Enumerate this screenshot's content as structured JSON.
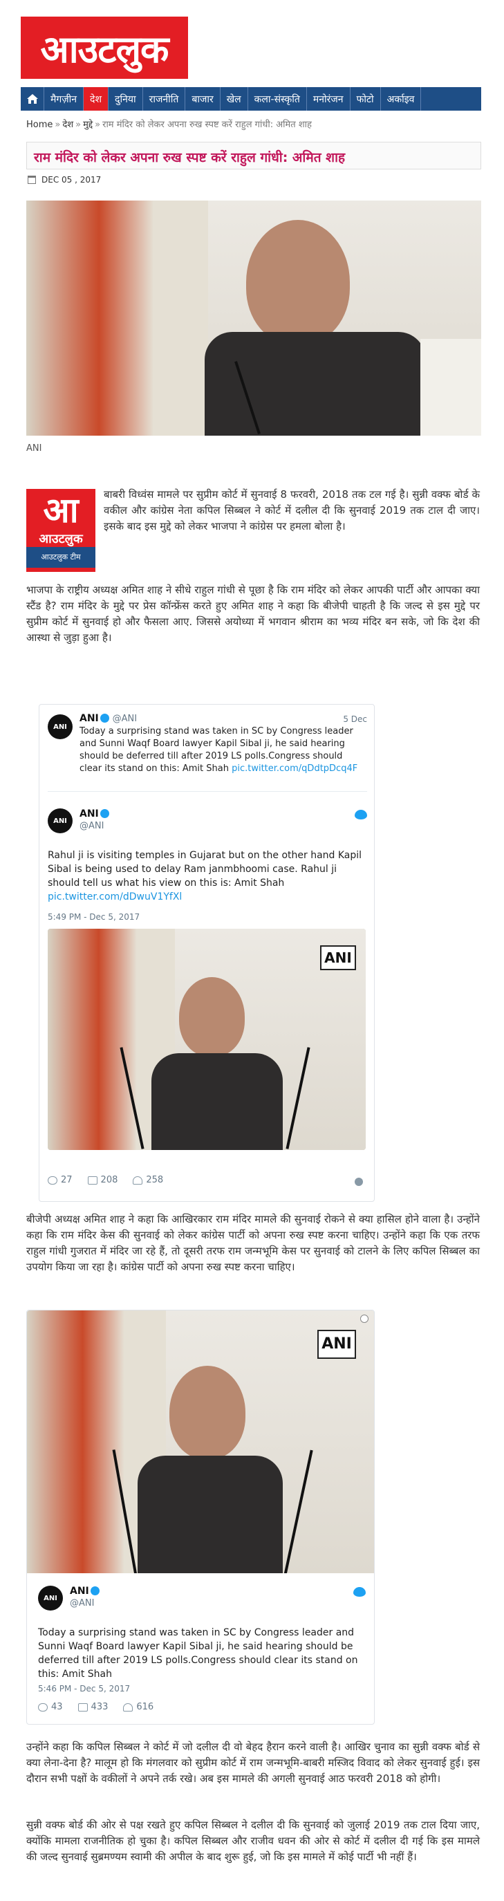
{
  "site": {
    "logo": "आउटलुक"
  },
  "nav": {
    "items": [
      "मैगज़ीन",
      "देश",
      "दुनिया",
      "राजनीति",
      "बाजार",
      "खेल",
      "कला-संस्कृति",
      "मनोरंजन",
      "फोटो",
      "अर्काइव"
    ],
    "active_index": 1,
    "colors": {
      "bar": "#1e4e86",
      "active": "#e31e24"
    }
  },
  "breadcrumb": {
    "home": "Home",
    "section": "देश",
    "sub": "मुद्दे",
    "current": "राम मंदिर को लेकर अपना रुख स्पष्ट करें राहुल गांधी: अमित शाह",
    "separator": "»"
  },
  "article": {
    "title": "राम मंदिर को लेकर अपना रुख स्पष्ट करें राहुल गांधी: अमित शाह",
    "date": "DEC 05 , 2017",
    "image_caption": "ANI",
    "author_badge": {
      "big": "आ",
      "mid": "आउटलुक",
      "small": "आउटलुक टीम"
    },
    "paragraphs": [
      "बाबरी विध्वंस मामले पर सुप्रीम कोर्ट में सुनवाई 8 फरवरी, 2018 तक टल गई है। सुन्नी वक्फ बोर्ड के वकील और कांग्रेस नेता कपिल सिब्बल ने कोर्ट में दलील दी कि सुनवाई 2019 तक टाल दी जाए। इसके बाद इस मुद्दे को लेकर भाजपा ने कांग्रेस पर हमला बोला है।",
      "भाजपा के राष्ट्रीय अध्यक्ष अमित शाह ने सीधे राहुल गांधी से पूछा है कि राम मंदिर को लेकर आपकी पार्टी और आपका क्या स्टैंड है? राम मंदिर के मुद्दे पर प्रेस कॉन्फ्रेंस करते हुए अमित शाह ने कहा कि बीजेपी चाहती है कि जल्द से इस मुद्दे पर सुप्रीम कोर्ट में सुनवाई हो और फैसला आए. जिससे अयोध्या में भगवान श्रीराम का भव्य मंदिर बन सके, जो कि देश की आस्था से जुड़ा हुआ है।",
      "बीजेपी अध्यक्ष अमित शाह ने कहा कि आखिरकार राम मंदिर मामले की सुनवाई रोकने से क्या हासिल होने वाला है। उन्होंने कहा कि राम मंदिर केस की सुनवाई को लेकर कांग्रेस पार्टी को अपना रुख स्पष्ट करना चाहिए। उन्होंने कहा कि एक तरफ राहुल गांधी गुजरात में मंदिर जा रहे हैं, तो दूसरी तरफ राम जन्मभूमि केस पर सुनवाई को टालने के लिए कपिल सिब्बल का उपयोग किया जा रहा है। कांग्रेस पार्टी को अपना रुख स्पष्ट करना चाहिए।",
      "उन्होंने कहा कि कपिल सिब्बल ने कोर्ट में जो दलील दी वो बेहद हैरान करने वाली है। आखिर चुनाव का सुन्नी वक्फ बोर्ड से क्या लेना-देना है? मालूम हो कि मंगलवार को सुप्रीम कोर्ट में राम जन्मभूमि-बाबरी मस्जिद विवाद को लेकर सुनवाई हुई। इस दौरान सभी पक्षों के वकीलों ने अपने तर्क रखे। अब इस मामले की अगली सुनवाई आठ फरवरी 2018 को होगी।",
      "सुन्नी वक्फ बोर्ड की ओर से पक्ष रखते हुए कपिल सिब्बल ने दलील दी कि सुनवाई को जुलाई 2019 तक टाल दिया जाए, क्योंकि मामला राजनीतिक हो चुका है। कपिल सिब्बल और राजीव धवन की ओर से कोर्ट में दलील दी गई कि इस मामले की जल्द सुनवाई सुब्रमण्यम स्वामी की अपील के बाद शुरू हुई, जो कि इस मामले में कोई पार्टी भी नहीं हैं।"
    ]
  },
  "tweet1": {
    "quoted": {
      "name": "ANI",
      "handle": "@ANI",
      "date": "5 Dec",
      "text": "Today a surprising stand was taken in SC by Congress leader and Sunni Waqf Board lawyer Kapil Sibal ji, he said hearing should be deferred till after 2019 LS polls.Congress should clear its stand on this: Amit Shah",
      "link": "pic.twitter.com/qDdtpDcq4F"
    },
    "name": "ANI",
    "handle": "@ANI",
    "text": "Rahul ji is visiting temples in Gujarat but on the other hand Kapil Sibal is being used to delay Ram janmbhoomi case. Rahul ji should tell us what his view on this is: Amit Shah",
    "link": "pic.twitter.com/dDwuV1YfXl",
    "time": "5:49 PM - Dec 5, 2017",
    "replies": "27",
    "retweets": "208",
    "likes": "258",
    "image_badge": "ANI"
  },
  "tweet2": {
    "name": "ANI",
    "handle": "@ANI",
    "text": "Today a surprising stand was taken in SC by Congress leader and Sunni Waqf Board lawyer Kapil Sibal ji, he said hearing should be deferred till after 2019 LS polls.Congress should clear its stand on this: Amit Shah",
    "time": "5:46 PM - Dec 5, 2017",
    "replies": "43",
    "retweets": "433",
    "likes": "616",
    "image_badge": "ANI"
  },
  "avatar_label": "ANI"
}
